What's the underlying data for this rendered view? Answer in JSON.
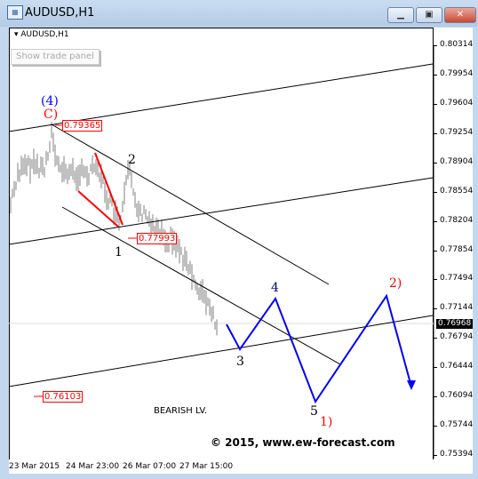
{
  "window": {
    "title": "AUDUSD,H1",
    "icon": "chart-window-icon",
    "buttons": [
      "minimize",
      "maximize",
      "close"
    ]
  },
  "chart": {
    "symbol_label": "AUDUSD,H1",
    "trade_panel_button": "Show trade panel",
    "price_axis": [
      "0.80314",
      "0.79954",
      "0.79604",
      "0.79254",
      "0.78904",
      "0.78554",
      "0.78204",
      "0.77854",
      "0.77494",
      "0.77144",
      "0.76794",
      "0.76444",
      "0.76094",
      "0.75744",
      "0.75394"
    ],
    "current_price": "0.76968",
    "time_axis": [
      "23 Mar 2015",
      "24 Mar 23:00",
      "26 Mar 07:00",
      "27 Mar 15:00"
    ],
    "price_markers": [
      "0.79365",
      "0.77993",
      "0.76103"
    ],
    "wave_labels": {
      "w4_major": "(4)",
      "wC": "C)",
      "w1": "1",
      "w2": "2",
      "w3": "3",
      "w4": "4",
      "w5": "5",
      "w1_major": "1)",
      "w2_major": "2)"
    },
    "annotation": "BEARISH LV.",
    "copyright": "© 2015, www.ew-forecast.com",
    "colors": {
      "projection": "#0000ff",
      "wave_major": "#ff0000",
      "wave_minor": "#000000",
      "bars": "#808080"
    }
  }
}
